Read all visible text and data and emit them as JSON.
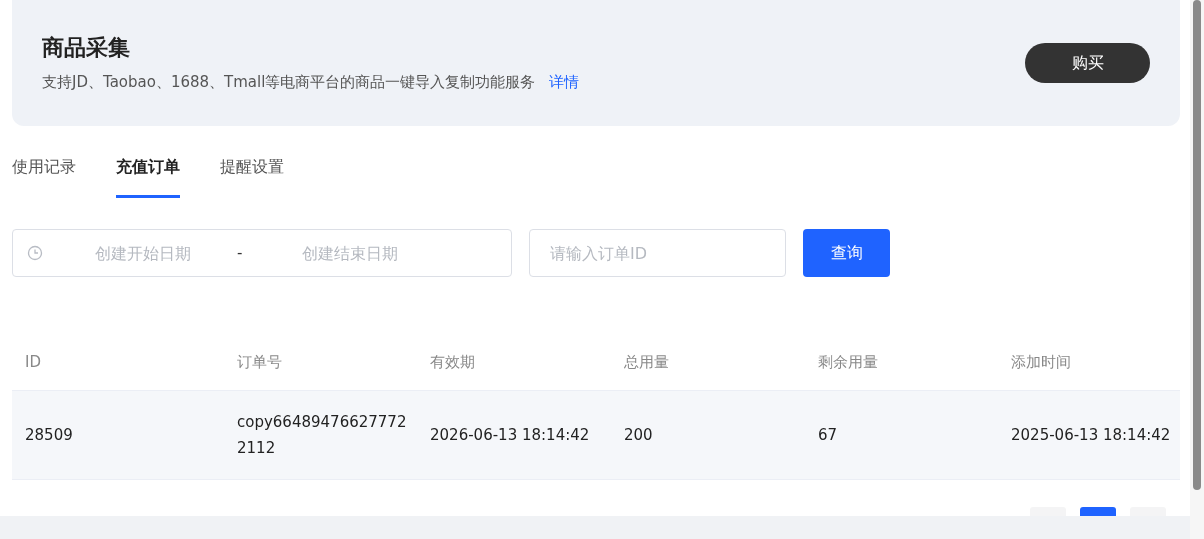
{
  "banner": {
    "title": "商品采集",
    "description": "支持JD、Taobao、1688、Tmall等电商平台的商品一键导入复制功能服务",
    "link": "详情",
    "button": "购买"
  },
  "tabs": [
    {
      "label": "使用记录",
      "selected": false
    },
    {
      "label": "充值订单",
      "selected": true
    },
    {
      "label": "提醒设置",
      "selected": false
    }
  ],
  "filters": {
    "start_date": {
      "placeholder": "创建开始日期"
    },
    "separator": "-",
    "end_date": {
      "placeholder": "创建结束日期"
    },
    "order_id": {
      "placeholder": "请输入订单ID"
    },
    "button": "查询"
  },
  "table": {
    "columns": [
      "ID",
      "订单号",
      "有效期",
      "总用量",
      "剩余用量",
      "添加时间"
    ],
    "rows": [
      [
        "28509",
        "copy664894766277722112",
        "2026-06-13 18:14:42",
        "200",
        "67",
        "2025-06-13 18:14:42"
      ]
    ]
  },
  "pagination": {
    "pages": [
      {
        "selected": false
      },
      {
        "selected": true
      },
      {
        "selected": false
      }
    ]
  }
}
